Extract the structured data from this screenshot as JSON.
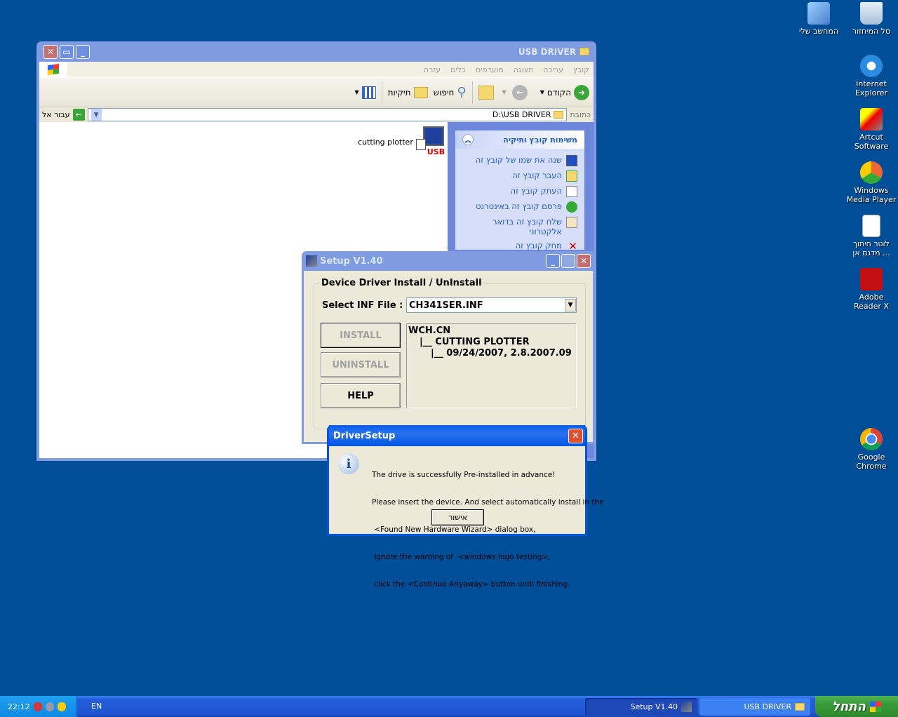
{
  "desktop_icons": [
    {
      "label": "המחשב שלי",
      "icon": "my-computer-icon"
    },
    {
      "label": "סל המיחזור",
      "icon": "recycle-bin-icon"
    },
    {
      "label": "Internet Explorer",
      "icon": "internet-explorer-icon"
    },
    {
      "label": "Artcut Software",
      "icon": "artcut-icon"
    },
    {
      "label": "Windows Media Player",
      "icon": "media-player-icon"
    },
    {
      "label": "לוטר חיתוך מדגם אן ...",
      "icon": "document-icon"
    },
    {
      "label": "Adobe Reader X",
      "icon": "adobe-reader-icon"
    },
    {
      "label": "Google Chrome",
      "icon": "chrome-icon"
    }
  ],
  "explorer": {
    "title": "USB DRIVER",
    "menu": [
      "קובץ",
      "עריכה",
      "תצוגה",
      "מועדפים",
      "כלים",
      "עזרה"
    ],
    "toolbar": {
      "back": "הקודם",
      "search": "חיפוש",
      "folders": "תיקיות"
    },
    "address_label": "כתובת",
    "address_value": "D:\\USB DRIVER",
    "go_label": "עבור אל",
    "file": {
      "name": "cutting plotter",
      "badge": "USB"
    },
    "task_pane": {
      "title": "משימות קובץ ותיקיה",
      "items": [
        {
          "label": "שנה את שמו של קובץ זה",
          "icon": "rename-icon"
        },
        {
          "label": "העבר קובץ זה",
          "icon": "move-icon"
        },
        {
          "label": "העתק קובץ זה",
          "icon": "copy-icon"
        },
        {
          "label": "פרסם קובץ זה באינטרנט",
          "icon": "publish-web-icon"
        },
        {
          "label": "שלח קובץ זה בדואר אלקטרוני",
          "icon": "email-icon"
        },
        {
          "label": "מחק קובץ זה",
          "icon": "delete-icon"
        }
      ]
    }
  },
  "setup": {
    "title": "Setup V1.40",
    "group_label": "Device Driver Install / UnInstall",
    "inf_label": "Select INF File :",
    "inf_value": "CH341SER.INF",
    "install": "INSTALL",
    "uninstall": "UNINSTALL",
    "help": "HELP",
    "tree": [
      "WCH.CN",
      "|__ CUTTING PLOTTER",
      "|__ 09/24/2007, 2.8.2007.09"
    ]
  },
  "dialog": {
    "title": "DriverSetup",
    "lines": [
      "The drive is successfully Pre-installed in advance!",
      "Please insert the device. And select automatically install in the",
      " <Found New Hardware Wizard> dialog box,",
      " ignore the warning of  <windows logo testing>,",
      " click the <Continue Anyaway> button until finishing."
    ],
    "ok": "אישור"
  },
  "taskbar": {
    "start": "התחל",
    "tasks": [
      "USB DRIVER",
      "Setup V1.40"
    ],
    "language": "EN",
    "clock": "22:12"
  }
}
